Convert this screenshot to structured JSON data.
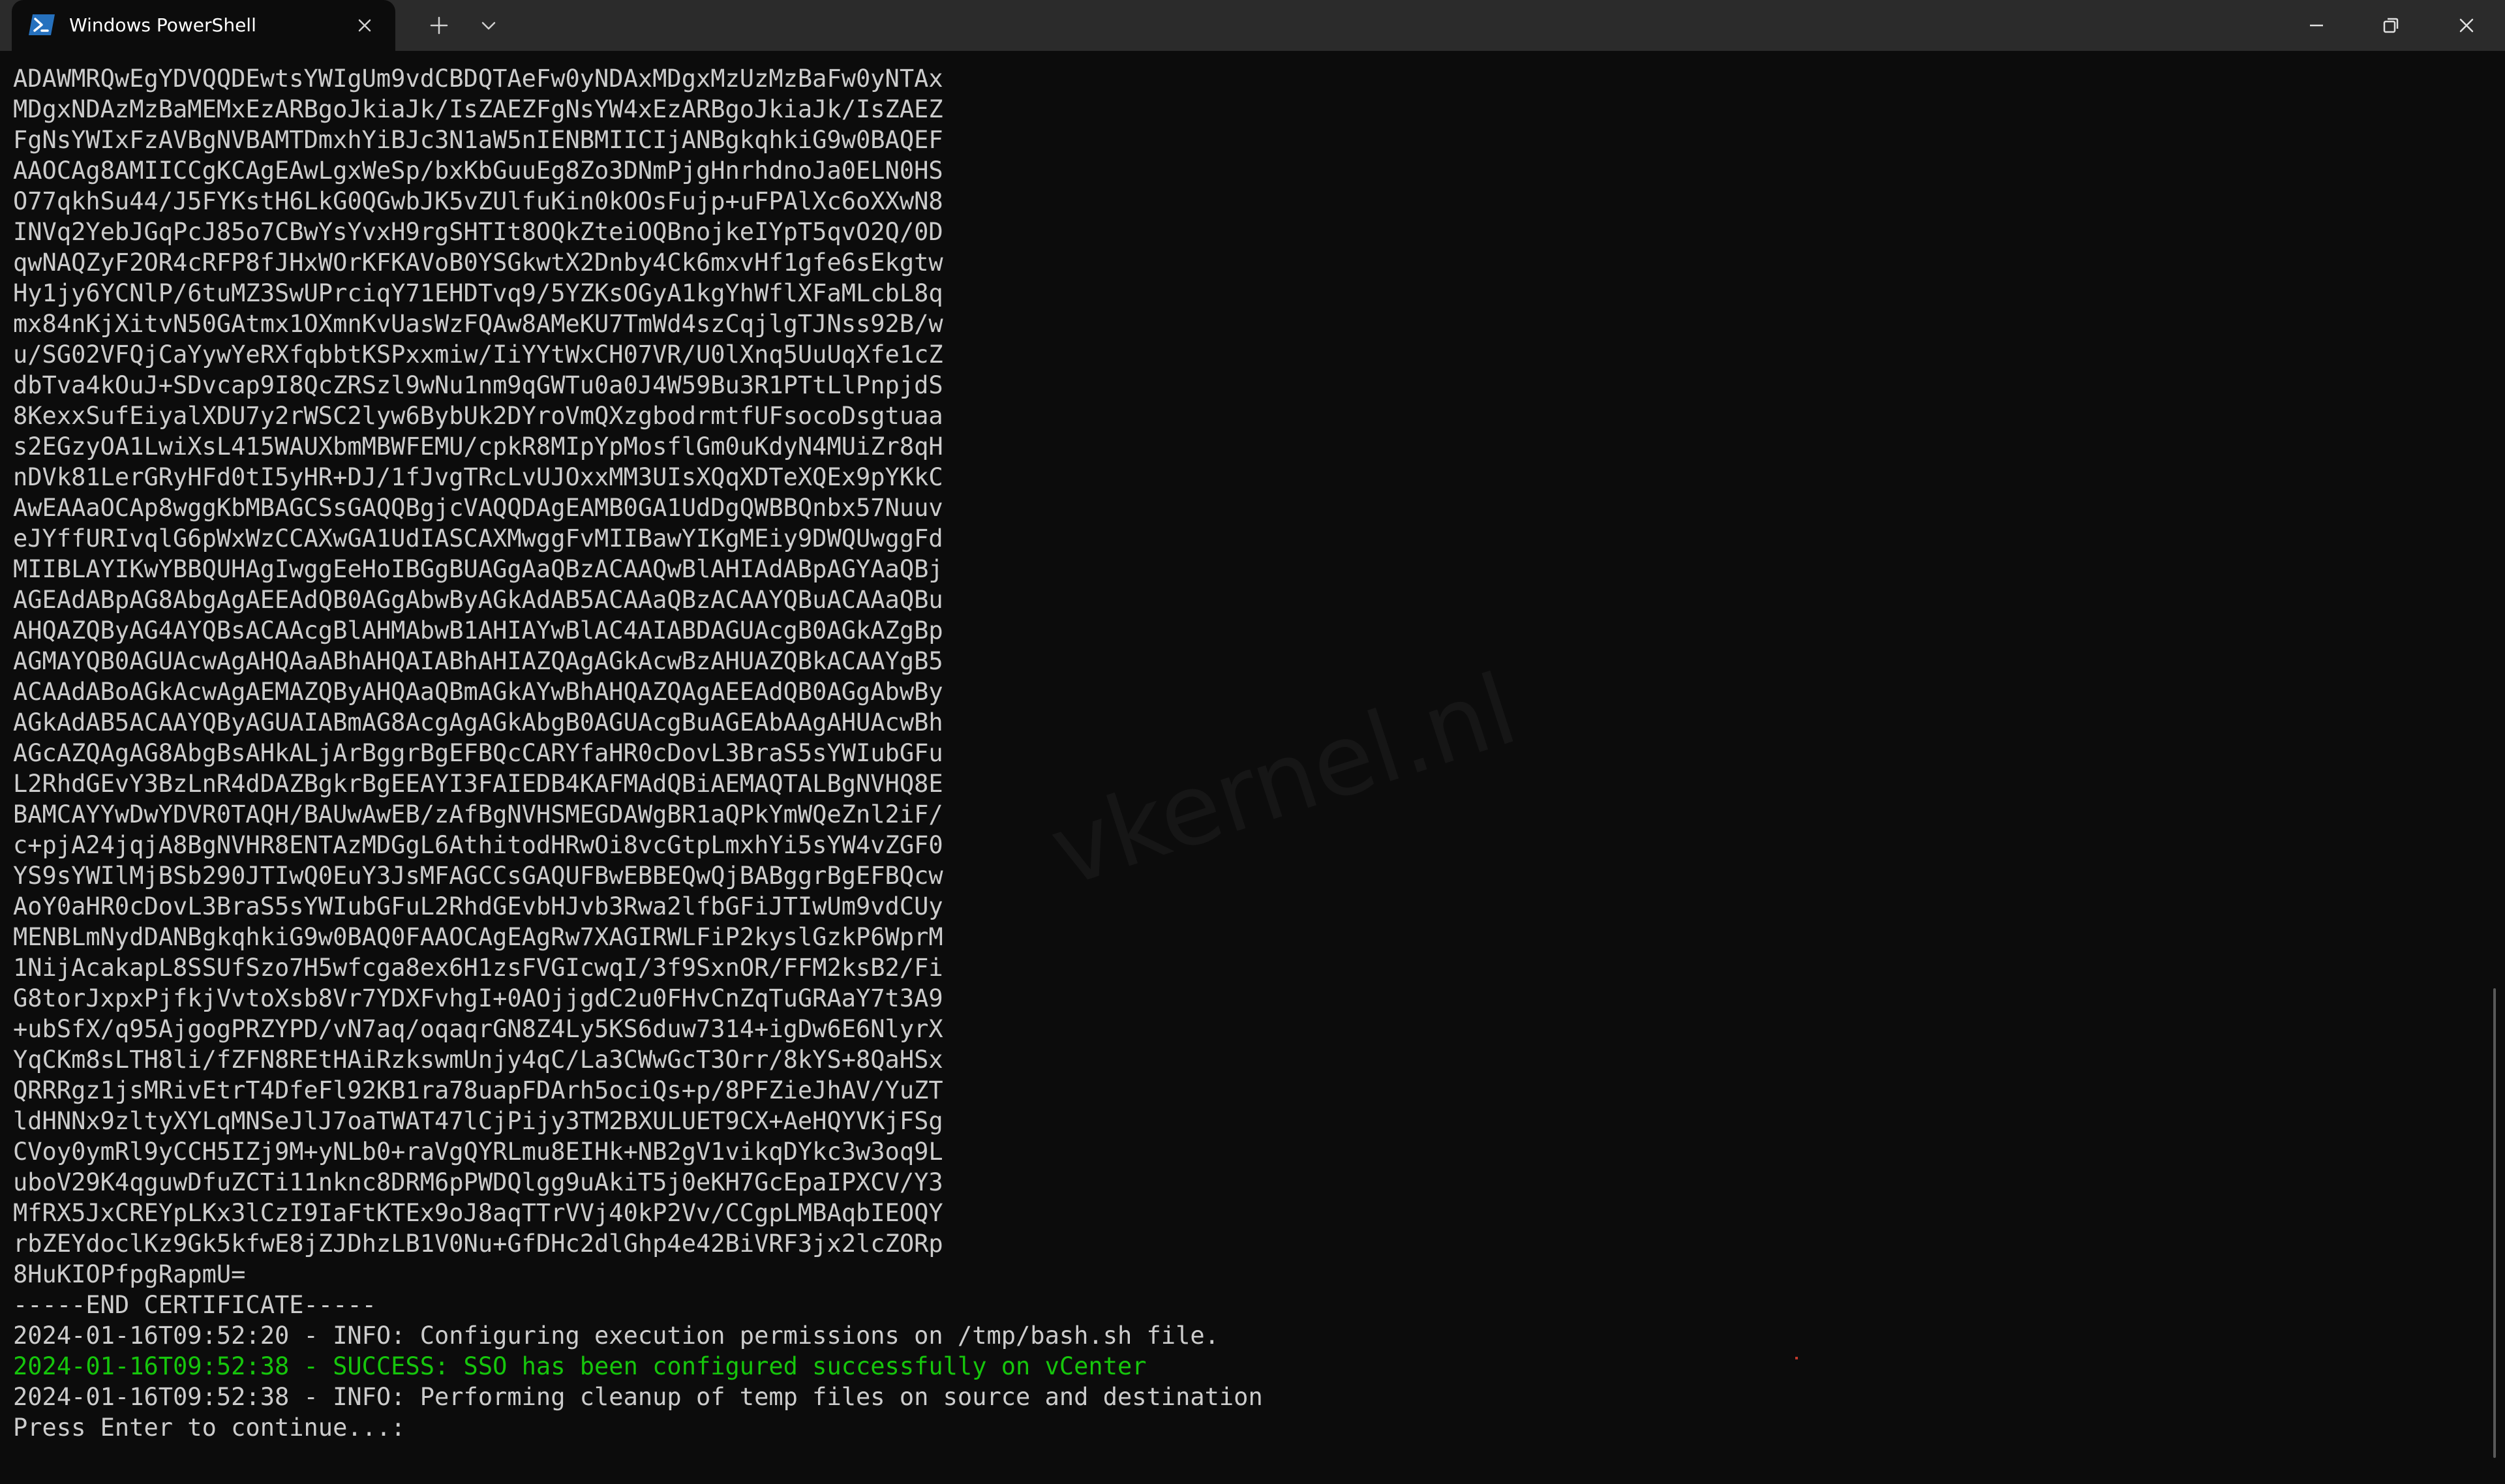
{
  "tab": {
    "title": "Windows PowerShell",
    "icon": "powershell-icon",
    "icon_color": "#2671be"
  },
  "window_controls": [
    "minimize-icon",
    "restore-icon",
    "close-icon"
  ],
  "watermark": "vkernel.nl",
  "colors": {
    "background": "#0c0c0c",
    "titlebar": "#2b2b2b",
    "text": "#cccccc",
    "success": "#16c60c"
  },
  "terminal": {
    "lines": [
      {
        "text": "ADAWMRQwEgYDVQQDEwtsYWIgUm9vdCBDQTAeFw0yNDAxMDgxMzUzMzBaFw0yNTAx",
        "type": "normal"
      },
      {
        "text": "MDgxNDAzMzBaMEMxEzARBgoJkiaJk/IsZAEZFgNsYW4xEzARBgoJkiaJk/IsZAEZ",
        "type": "normal"
      },
      {
        "text": "FgNsYWIxFzAVBgNVBAMTDmxhYiBJc3N1aW5nIENBMIICIjANBgkqhkiG9w0BAQEF",
        "type": "normal"
      },
      {
        "text": "AAOCAg8AMIICCgKCAgEAwLgxWeSp/bxKbGuuEg8Zo3DNmPjgHnrhdnoJa0ELN0HS",
        "type": "normal"
      },
      {
        "text": "O77qkhSu44/J5FYKstH6LkG0QGwbJK5vZUlfuKin0kOOsFujp+uFPAlXc6oXXwN8",
        "type": "normal"
      },
      {
        "text": "INVq2YebJGqPcJ85o7CBwYsYvxH9rgSHTIt8OQkZteiOQBnojkeIYpT5qvO2Q/0D",
        "type": "normal"
      },
      {
        "text": "qwNAQZyF2OR4cRFP8fJHxWOrKFKAVoB0YSGkwtX2Dnby4Ck6mxvHf1gfe6sEkgtw",
        "type": "normal"
      },
      {
        "text": "Hy1jy6YCNlP/6tuMZ3SwUPrciqY71EHDTvq9/5YZKsOGyA1kgYhWflXFaMLcbL8q",
        "type": "normal"
      },
      {
        "text": "mx84nKjXitvN50GAtmx1OXmnKvUasWzFQAw8AMeKU7TmWd4szCqjlgTJNss92B/w",
        "type": "normal"
      },
      {
        "text": "u/SG02VFQjCaYywYeRXfqbbtKSPxxmiw/IiYYtWxCH07VR/U0lXnq5UuUqXfe1cZ",
        "type": "normal"
      },
      {
        "text": "dbTva4kOuJ+SDvcap9I8QcZRSzl9wNu1nm9qGWTu0a0J4W59Bu3R1PTtLlPnpjdS",
        "type": "normal"
      },
      {
        "text": "8KexxSufEiyalXDU7y2rWSC2lyw6BybUk2DYroVmQXzgbodrmtfUFsocoDsgtuaa",
        "type": "normal"
      },
      {
        "text": "s2EGzyOA1LwiXsL415WAUXbmMBWFEMU/cpkR8MIpYpMosflGm0uKdyN4MUiZr8qH",
        "type": "normal"
      },
      {
        "text": "nDVk81LerGRyHFd0tI5yHR+DJ/1fJvgTRcLvUJOxxMM3UIsXQqXDTeXQEx9pYKkC",
        "type": "normal"
      },
      {
        "text": "AwEAAaOCAp8wggKbMBAGCSsGAQQBgjcVAQQDAgEAMB0GA1UdDgQWBBQnbx57Nuuv",
        "type": "normal"
      },
      {
        "text": "eJYffURIvqlG6pWxWzCCAXwGA1UdIASCAXMwggFvMIIBawYIKgMEiy9DWQUwggFd",
        "type": "normal"
      },
      {
        "text": "MIIBLAYIKwYBBQUHAgIwggEeHoIBGgBUAGgAaQBzACAAQwBlAHIAdABpAGYAaQBj",
        "type": "normal"
      },
      {
        "text": "AGEAdABpAG8AbgAgAEEAdQB0AGgAbwByAGkAdAB5ACAAaQBzACAAYQBuACAAaQBu",
        "type": "normal"
      },
      {
        "text": "AHQAZQByAG4AYQBsACAAcgBlAHMAbwB1AHIAYwBlAC4AIABDAGUAcgB0AGkAZgBp",
        "type": "normal"
      },
      {
        "text": "AGMAYQB0AGUAcwAgAHQAaABhAHQAIABhAHIAZQAgAGkAcwBzAHUAZQBkACAAYgB5",
        "type": "normal"
      },
      {
        "text": "ACAAdABoAGkAcwAgAEMAZQByAHQAaQBmAGkAYwBhAHQAZQAgAEEAdQB0AGgAbwBy",
        "type": "normal"
      },
      {
        "text": "AGkAdAB5ACAAYQByAGUAIABmAG8AcgAgAGkAbgB0AGUAcgBuAGEAbAAgAHUAcwBh",
        "type": "normal"
      },
      {
        "text": "AGcAZQAgAG8AbgBsAHkALjArBggrBgEFBQcCARYfaHR0cDovL3BraS5sYWIubGFu",
        "type": "normal"
      },
      {
        "text": "L2RhdGEvY3BzLnR4dDAZBgkrBgEEAYI3FAIEDB4KAFMAdQBiAEMAQTALBgNVHQ8E",
        "type": "normal"
      },
      {
        "text": "BAMCAYYwDwYDVR0TAQH/BAUwAwEB/zAfBgNVHSMEGDAWgBR1aQPkYmWQeZnl2iF/",
        "type": "normal"
      },
      {
        "text": "c+pjA24jqjA8BgNVHR8ENTAzMDGgL6AthitodHRwOi8vcGtpLmxhYi5sYW4vZGF0",
        "type": "normal"
      },
      {
        "text": "YS9sYWIlMjBSb290JTIwQ0EuY3JsMFAGCCsGAQUFBwEBBEQwQjBABggrBgEFBQcw",
        "type": "normal"
      },
      {
        "text": "AoY0aHR0cDovL3BraS5sYWIubGFuL2RhdGEvbHJvb3Rwa2lfbGFiJTIwUm9vdCUy",
        "type": "normal"
      },
      {
        "text": "MENBLmNydDANBgkqhkiG9w0BAQ0FAAOCAgEAgRw7XAGIRWLFiP2kyslGzkP6WprM",
        "type": "normal"
      },
      {
        "text": "1NijAcakapL8SSUfSzo7H5wfcga8ex6H1zsFVGIcwqI/3f9SxnOR/FFM2ksB2/Fi",
        "type": "normal"
      },
      {
        "text": "G8torJxpxPjfkjVvtoXsb8Vr7YDXFvhgI+0AOjjgdC2u0FHvCnZqTuGRAaY7t3A9",
        "type": "normal"
      },
      {
        "text": "+ubSfX/q95AjgogPRZYPD/vN7aq/oqaqrGN8Z4Ly5KS6duw7314+igDw6E6NlyrX",
        "type": "normal"
      },
      {
        "text": "YqCKm8sLTH8li/fZFN8REtHAiRzkswmUnjy4qC/La3CWwGcT3Orr/8kYS+8QaHSx",
        "type": "normal"
      },
      {
        "text": "QRRRgz1jsMRivEtrT4DfeFl92KB1ra78uapFDArh5ociQs+p/8PFZieJhAV/YuZT",
        "type": "normal"
      },
      {
        "text": "ldHNNx9zltyXYLqMNSeJlJ7oaTWAT47lCjPijy3TM2BXULUET9CX+AeHQYVKjFSg",
        "type": "normal"
      },
      {
        "text": "CVoy0ymRl9yCCH5IZj9M+yNLb0+raVgQYRLmu8EIHk+NB2gV1vikqDYkc3w3oq9L",
        "type": "normal"
      },
      {
        "text": "uboV29K4qguwDfuZCTi11nknc8DRM6pPWDQlgg9uAkiT5j0eKH7GcEpaIPXCV/Y3",
        "type": "normal"
      },
      {
        "text": "MfRX5JxCREYpLKx3lCzI9IaFtKTEx9oJ8aqTTrVVj40kP2Vv/CCgpLMBAqbIEOQY",
        "type": "normal"
      },
      {
        "text": "rbZEYdoclKz9Gk5kfwE8jZJDhzLB1V0Nu+GfDHc2dlGhp4e42BiVRF3jx2lcZORp",
        "type": "normal"
      },
      {
        "text": "8HuKIOPfpgRapmU=",
        "type": "normal"
      },
      {
        "text": "-----END CERTIFICATE-----",
        "type": "normal"
      },
      {
        "text": "2024-01-16T09:52:20 - INFO: Configuring execution permissions on /tmp/bash.sh file.",
        "type": "normal"
      },
      {
        "text": "2024-01-16T09:52:38 - SUCCESS: SSO has been configured successfully on vCenter",
        "type": "success"
      },
      {
        "text": "2024-01-16T09:52:38 - INFO: Performing cleanup of temp files on source and destination",
        "type": "normal"
      },
      {
        "text": "Press Enter to continue...:",
        "type": "normal"
      }
    ]
  }
}
